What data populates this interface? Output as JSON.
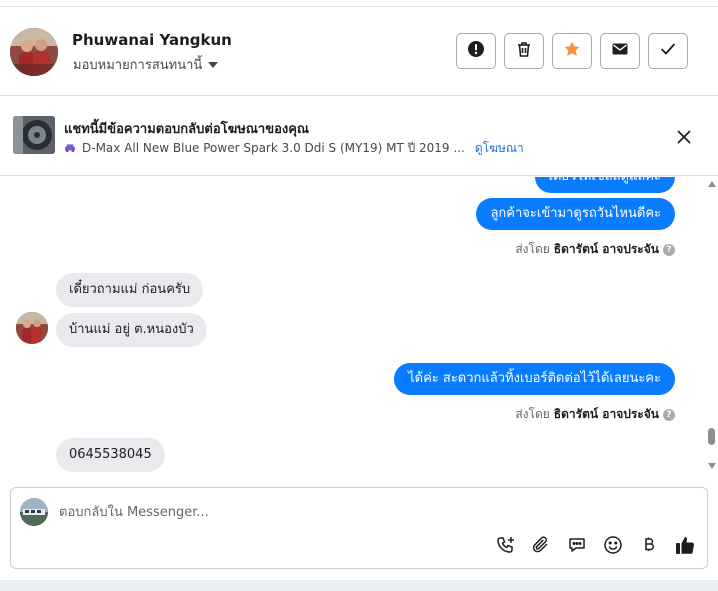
{
  "header": {
    "contact_name": "Phuwanai Yangkun",
    "assign_label": "มอบหมายการสนทนานี้",
    "buttons": [
      "report-icon",
      "trash-icon",
      "star-icon",
      "mail-icon",
      "check-icon"
    ]
  },
  "ad": {
    "title": "แชทนี้มีข้อความตอบกลับต่อโฆษณาของคุณ",
    "subtitle": "D-Max All New Blue Power Spark 3.0 Ddi S (MY19) MT ปี 2019 ...",
    "link": "ดูโฆษณา"
  },
  "messages": [
    {
      "side": "out",
      "text": "เดี๋ยวให้เซลล์ดูแลค่ะ"
    },
    {
      "side": "out",
      "text": "ลูกค้าจะเข้ามาดูรถวันไหนดีคะ"
    },
    {
      "side": "meta",
      "prefix": "ส่งโดย",
      "sender": "ธิดารัตน์ อาจประจัน"
    },
    {
      "side": "in",
      "text": "เดี๋ยวถามแม่ ก่อนครับ"
    },
    {
      "side": "in",
      "text": "บ้านแม่ อยู่ ต.หนองบัว"
    },
    {
      "side": "out",
      "text": "ได้ค่ะ สะดวกแล้วทิ้งเบอร์ติดต่อไว้ได้เลยนะคะ"
    },
    {
      "side": "meta",
      "prefix": "ส่งโดย",
      "sender": "ธิดารัตน์ อาจประจัน"
    },
    {
      "side": "in",
      "text": "0645538045"
    }
  ],
  "composer": {
    "placeholder": "ตอบกลับใน Messenger...",
    "tools": [
      "phone-add-icon",
      "paperclip-icon",
      "chat-bubble-icon",
      "emoji-icon",
      "baht-icon",
      "thumbs-up-icon"
    ]
  },
  "colors": {
    "accent": "#0a7cff",
    "incoming_bubble": "#e9eaed",
    "star": "#f7923b",
    "link": "#216fdb"
  }
}
